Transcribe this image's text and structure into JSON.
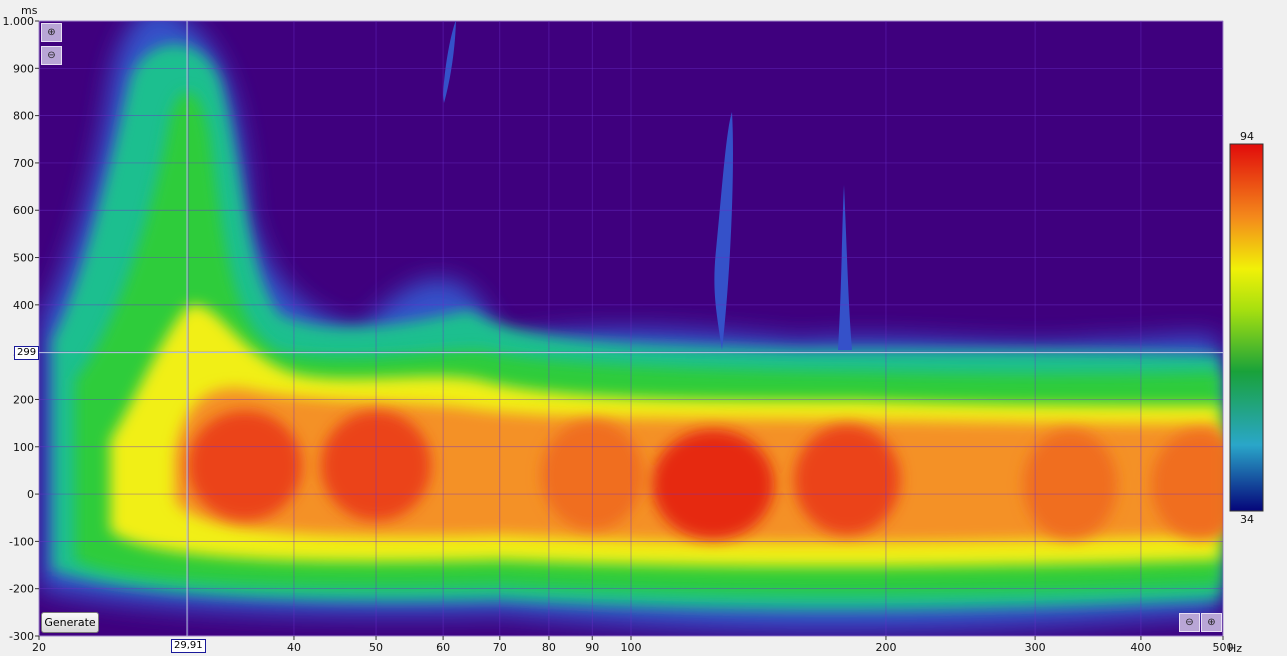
{
  "chart_data": {
    "type": "heatmap",
    "title": "",
    "x_unit": "Hz",
    "y_unit": "ms",
    "x_scale": "log",
    "xlim": [
      20,
      500
    ],
    "ylim": [
      -300,
      1000
    ],
    "x_ticks": [
      20,
      40,
      50,
      60,
      70,
      80,
      90,
      100,
      200,
      300,
      400,
      500
    ],
    "y_ticks": [
      -300,
      -200,
      -100,
      0,
      100,
      200,
      300,
      400,
      500,
      600,
      700,
      800,
      900,
      1000
    ],
    "y_tick_labels": [
      "-300",
      "-200",
      "-100",
      "0",
      "100",
      "200",
      "300",
      "400",
      "500",
      "600",
      "700",
      "800",
      "900",
      "1.000"
    ],
    "colorbar": {
      "min": 34,
      "max": 94,
      "min_label": "34",
      "max_label": "94"
    },
    "cursor": {
      "x_label": "29,91",
      "y_label": "299",
      "x": 29.91,
      "y": 299
    },
    "peak_regions": [
      {
        "freq": 35,
        "time": 60,
        "level": 91
      },
      {
        "freq": 50,
        "time": 60,
        "level": 90
      },
      {
        "freq": 90,
        "time": 40,
        "level": 88
      },
      {
        "freq": 125,
        "time": 20,
        "level": 93
      },
      {
        "freq": 180,
        "time": 30,
        "level": 89
      },
      {
        "freq": 330,
        "time": 20,
        "level": 86
      },
      {
        "freq": 470,
        "time": 20,
        "level": 87
      }
    ]
  },
  "buttons": {
    "generate_label": "Generate"
  },
  "colors": {
    "background": "#3f007e",
    "low": "#1c1aa0",
    "mid": "#22b24b",
    "high": "#e62c16"
  }
}
